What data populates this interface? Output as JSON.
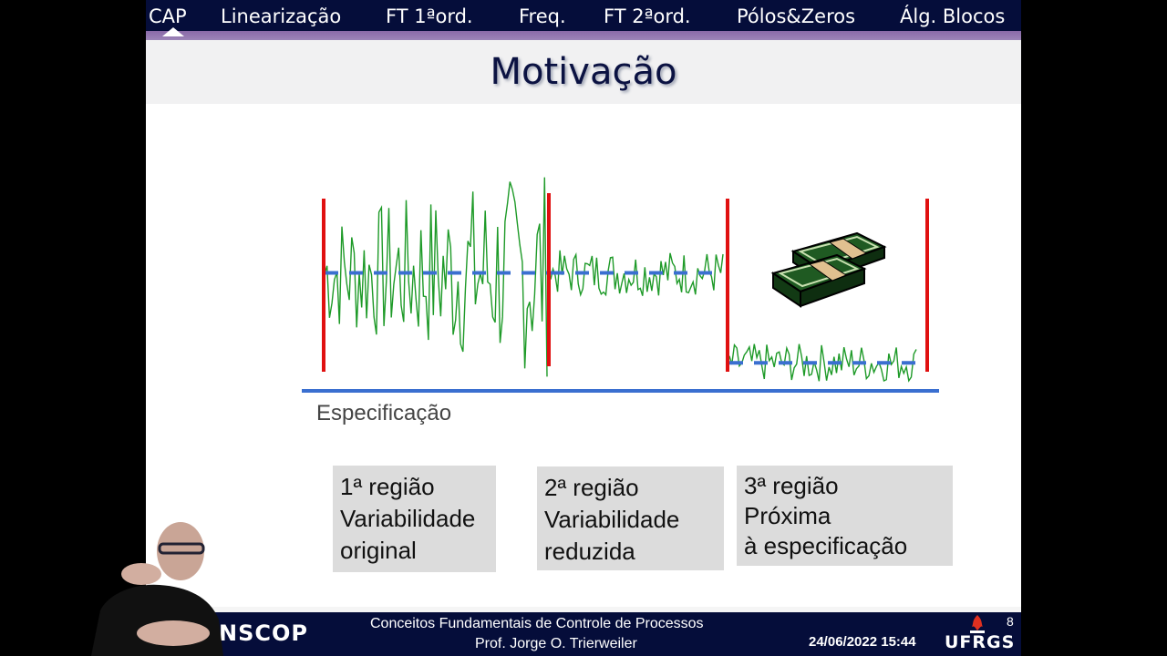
{
  "navbar": {
    "items": [
      {
        "label": "CAP",
        "active": true
      },
      {
        "label": "Linearização"
      },
      {
        "label": "FT 1ªord."
      },
      {
        "label": "Freq."
      },
      {
        "label": "FT 2ªord."
      },
      {
        "label": "Pólos&Zeros"
      },
      {
        "label": "Álg. Blocos"
      }
    ]
  },
  "slide": {
    "title": "Motivação",
    "specification_label": "Especificação",
    "money_icon": "money-stack-icon",
    "regions": [
      {
        "lines": [
          "1ª região",
          "Variabilidade",
          "original"
        ]
      },
      {
        "lines": [
          "2ª região",
          "Variabilidade",
          "reduzida"
        ]
      },
      {
        "lines": [
          "3ª região",
          "Próxima",
          "à especificação"
        ]
      }
    ]
  },
  "colors": {
    "navbar_bg": "#050d3a",
    "signal": "#1e9a28",
    "setpoint": "#3a6fd0",
    "boundary": "#e01010",
    "spec_line": "#3a6fd0"
  },
  "chart_data": {
    "type": "line",
    "title": "",
    "xlabel": "",
    "ylabel": "",
    "description": "Process signal (green) with mean setpoint (dashed blue) in three regions separated by red lines; solid blue line marks the specification limit.",
    "regions": [
      {
        "name": "1ª região",
        "mean": 0.55,
        "amplitude": 0.5
      },
      {
        "name": "2ª região",
        "mean": 0.55,
        "amplitude": 0.12
      },
      {
        "name": "3ª região",
        "mean": 0.08,
        "amplitude": 0.1
      }
    ],
    "specification": 0.0
  },
  "footer": {
    "logo_text": "NSCOP",
    "course": "Conceitos  Fundamentais de Controle de Processos",
    "professor": "Prof. Jorge O. Trierweiler",
    "datetime": "24/06/2022 15:44",
    "page": "8",
    "university": "UFRGS"
  }
}
